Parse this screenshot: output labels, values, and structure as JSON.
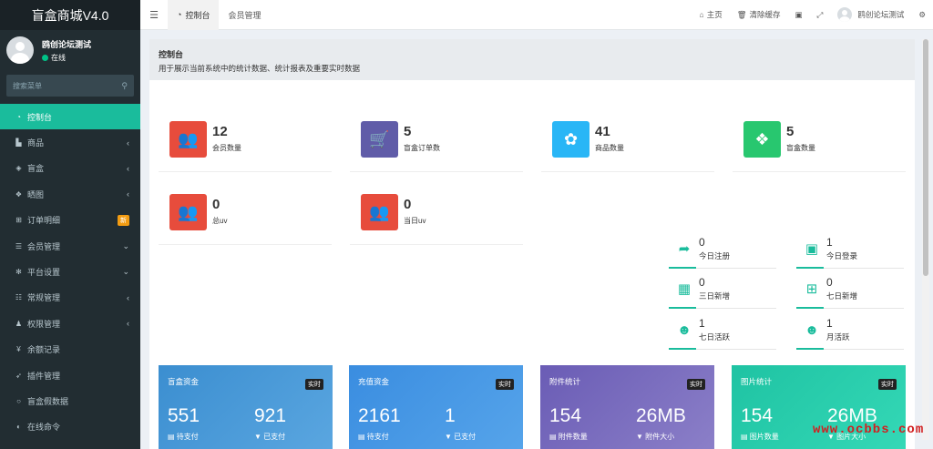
{
  "app": {
    "title": "盲盒商城V4.0"
  },
  "user": {
    "name": "鸥创论坛测试",
    "status": "在线"
  },
  "search": {
    "placeholder": "搜索菜单"
  },
  "menu": [
    {
      "label": "控制台",
      "icon": "dashboard-icon",
      "glyph": "◔",
      "arrow": "",
      "active": true
    },
    {
      "label": "商品",
      "icon": "briefcase-icon",
      "glyph": "▙",
      "arrow": "‹"
    },
    {
      "label": "盲盒",
      "icon": "cube-icon",
      "glyph": "◈",
      "arrow": "‹"
    },
    {
      "label": "晒图",
      "icon": "dropbox-icon",
      "glyph": "❖",
      "arrow": "‹"
    },
    {
      "label": "订单明细",
      "icon": "cart-icon",
      "glyph": "⊞",
      "badge": "新"
    },
    {
      "label": "会员管理",
      "icon": "list-icon",
      "glyph": "☰",
      "arrow": "⌄"
    },
    {
      "label": "平台设置",
      "icon": "gear-icon",
      "glyph": "✻",
      "arrow": "⌄"
    },
    {
      "label": "常规管理",
      "icon": "database-icon",
      "glyph": "☷",
      "arrow": "‹"
    },
    {
      "label": "权限管理",
      "icon": "users-icon",
      "glyph": "♟",
      "arrow": "‹"
    },
    {
      "label": "余额记录",
      "icon": "yen-icon",
      "glyph": "¥",
      "arrow": ""
    },
    {
      "label": "插件管理",
      "icon": "rocket-icon",
      "glyph": "➶",
      "arrow": ""
    },
    {
      "label": "盲盒假数据",
      "icon": "circle-icon",
      "glyph": "○",
      "arrow": ""
    },
    {
      "label": "在线命令",
      "icon": "adjust-icon",
      "glyph": "◐",
      "arrow": ""
    }
  ],
  "header": {
    "tabs": [
      {
        "label": "控制台",
        "icon": "dashboard-icon",
        "active": true
      },
      {
        "label": "会员管理"
      }
    ],
    "home": "主页",
    "clear_cache": "清除缓存",
    "user_name": "鸥创论坛测试"
  },
  "panel": {
    "title": "控制台",
    "description": "用于展示当前系统中的统计数据、统计报表及重要实时数据"
  },
  "stats": [
    {
      "value": "12",
      "label": "会员数量",
      "icon": "users-icon",
      "color": "#e74c3c"
    },
    {
      "value": "5",
      "label": "盲盒订单数",
      "icon": "cart-icon",
      "color": "#605ca8"
    },
    {
      "value": "41",
      "label": "商品数量",
      "icon": "leaf-icon",
      "color": "#29b6f6"
    },
    {
      "value": "5",
      "label": "盲盒数量",
      "icon": "dropbox-icon",
      "color": "#28c76f"
    },
    {
      "value": "0",
      "label": "总uv",
      "icon": "users-icon",
      "color": "#e74c3c"
    },
    {
      "value": "0",
      "label": "当日uv",
      "icon": "users-icon",
      "color": "#e74c3c"
    }
  ],
  "mini_stats": [
    {
      "value": "0",
      "label": "今日注册",
      "icon": "rocket-icon"
    },
    {
      "value": "1",
      "label": "今日登录",
      "icon": "id-card-icon"
    },
    {
      "value": "0",
      "label": "三日新增",
      "icon": "calendar-icon"
    },
    {
      "value": "0",
      "label": "七日新增",
      "icon": "calendar-plus-icon"
    },
    {
      "value": "1",
      "label": "七日活跃",
      "icon": "user-circle-icon"
    },
    {
      "value": "1",
      "label": "月活跃",
      "icon": "user-circle-icon"
    }
  ],
  "cards": [
    {
      "title": "盲盒资金",
      "tag": "实时",
      "v1": "551",
      "l1": "待支付",
      "v2": "921",
      "l2": "已支付",
      "color1": "#3b8ed0",
      "color2": "#5aa6e0"
    },
    {
      "title": "充值资金",
      "tag": "实时",
      "v1": "2161",
      "l1": "待支付",
      "v2": "1",
      "l2": "已支付",
      "color1": "#3a8de0",
      "color2": "#56a4ea"
    },
    {
      "title": "附件统计",
      "tag": "实时",
      "v1": "154",
      "l1": "附件数量",
      "v2": "26MB",
      "l2": "附件大小",
      "color1": "#6a5cb5",
      "color2": "#8b7fc8"
    },
    {
      "title": "图片统计",
      "tag": "实时",
      "v1": "154",
      "l1": "图片数量",
      "v2": "26MB",
      "l2": "图片大小",
      "color1": "#1fc3a3",
      "color2": "#34d8b6"
    }
  ],
  "watermark": "www.ocbbs.com"
}
